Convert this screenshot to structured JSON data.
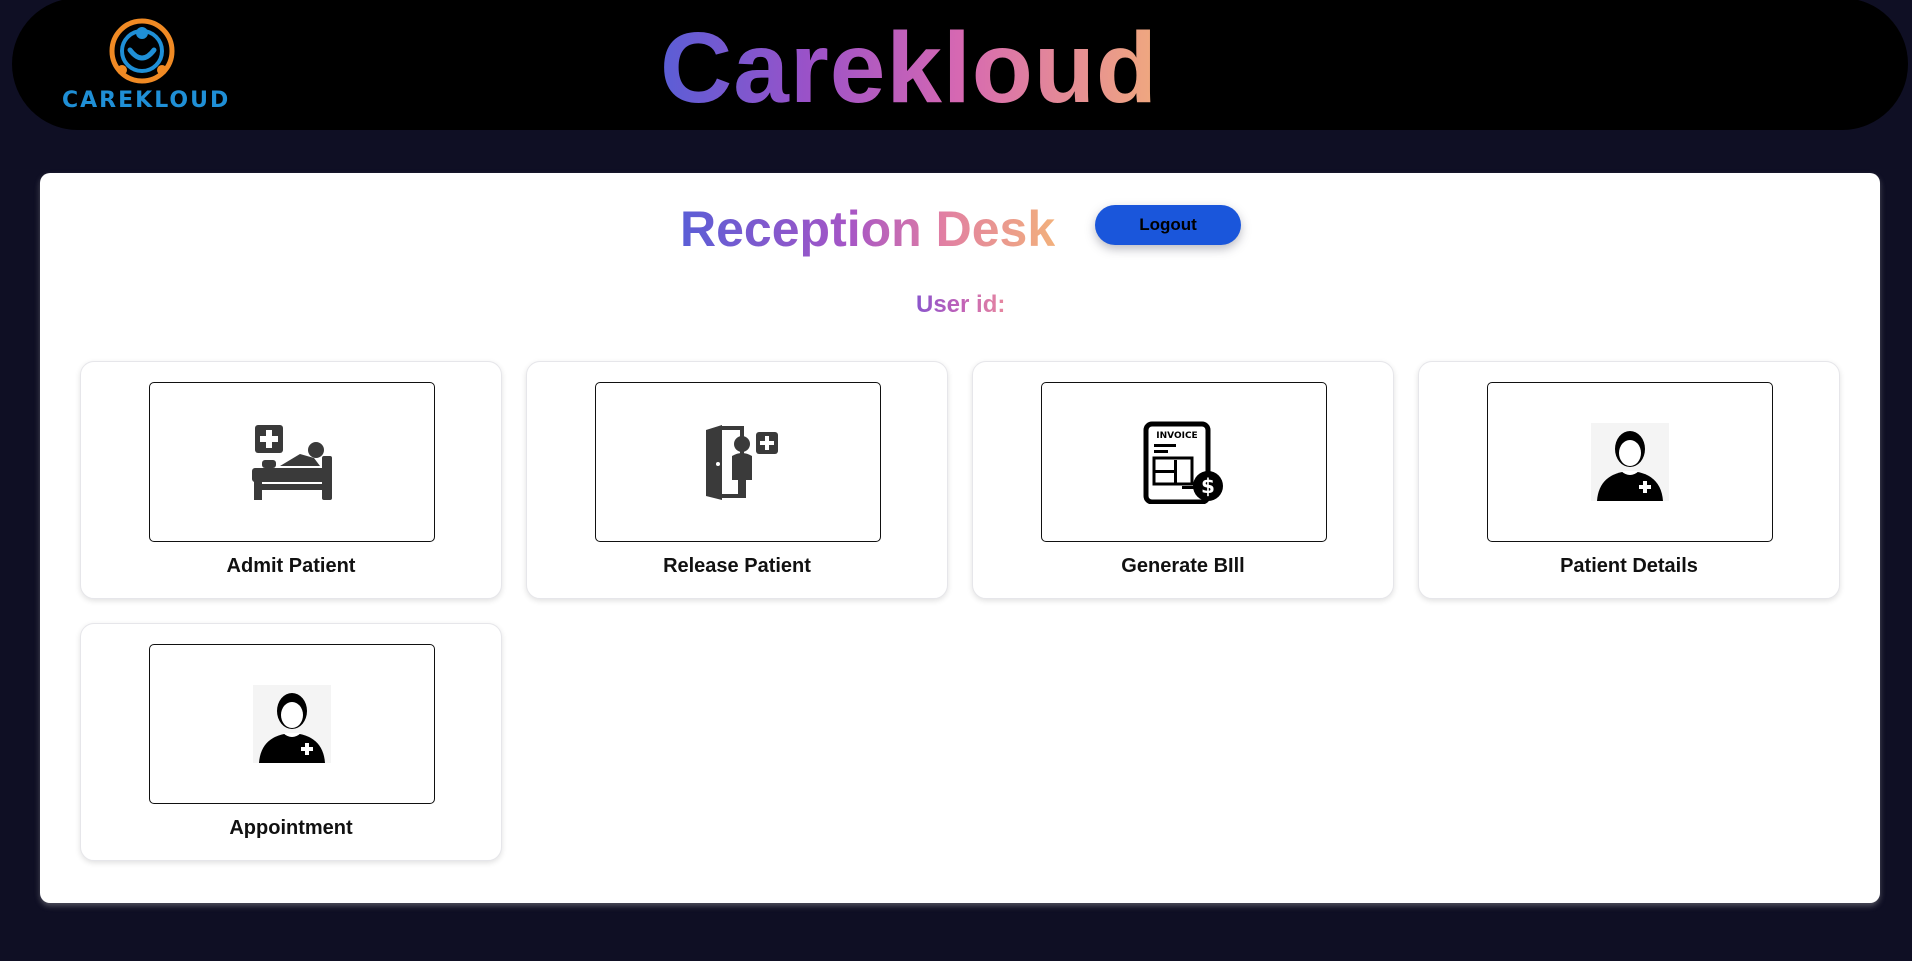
{
  "header": {
    "brand_title": "Carekloud",
    "logo_text": "CAREKLOUD"
  },
  "panel": {
    "title": "Reception Desk",
    "logout_label": "Logout",
    "user_id_label": "User id:"
  },
  "cards": [
    {
      "label": "Admit Patient",
      "icon": "hospital-bed-icon"
    },
    {
      "label": "Release Patient",
      "icon": "discharge-door-icon"
    },
    {
      "label": "Generate BIll",
      "icon": "invoice-icon"
    },
    {
      "label": "Patient Details",
      "icon": "patient-profile-icon"
    },
    {
      "label": "Appointment",
      "icon": "patient-profile-icon"
    }
  ],
  "colors": {
    "background": "#0f0f24",
    "header_bg": "#000000",
    "logout_button": "#1a56db",
    "title_gradient": [
      "#5a5ed6",
      "#9b52c8",
      "#d668b2",
      "#f0a97e"
    ],
    "logo_blue": "#1f8fd6",
    "logo_orange": "#f08a24"
  },
  "invoice_icon_text": "INVOICE"
}
